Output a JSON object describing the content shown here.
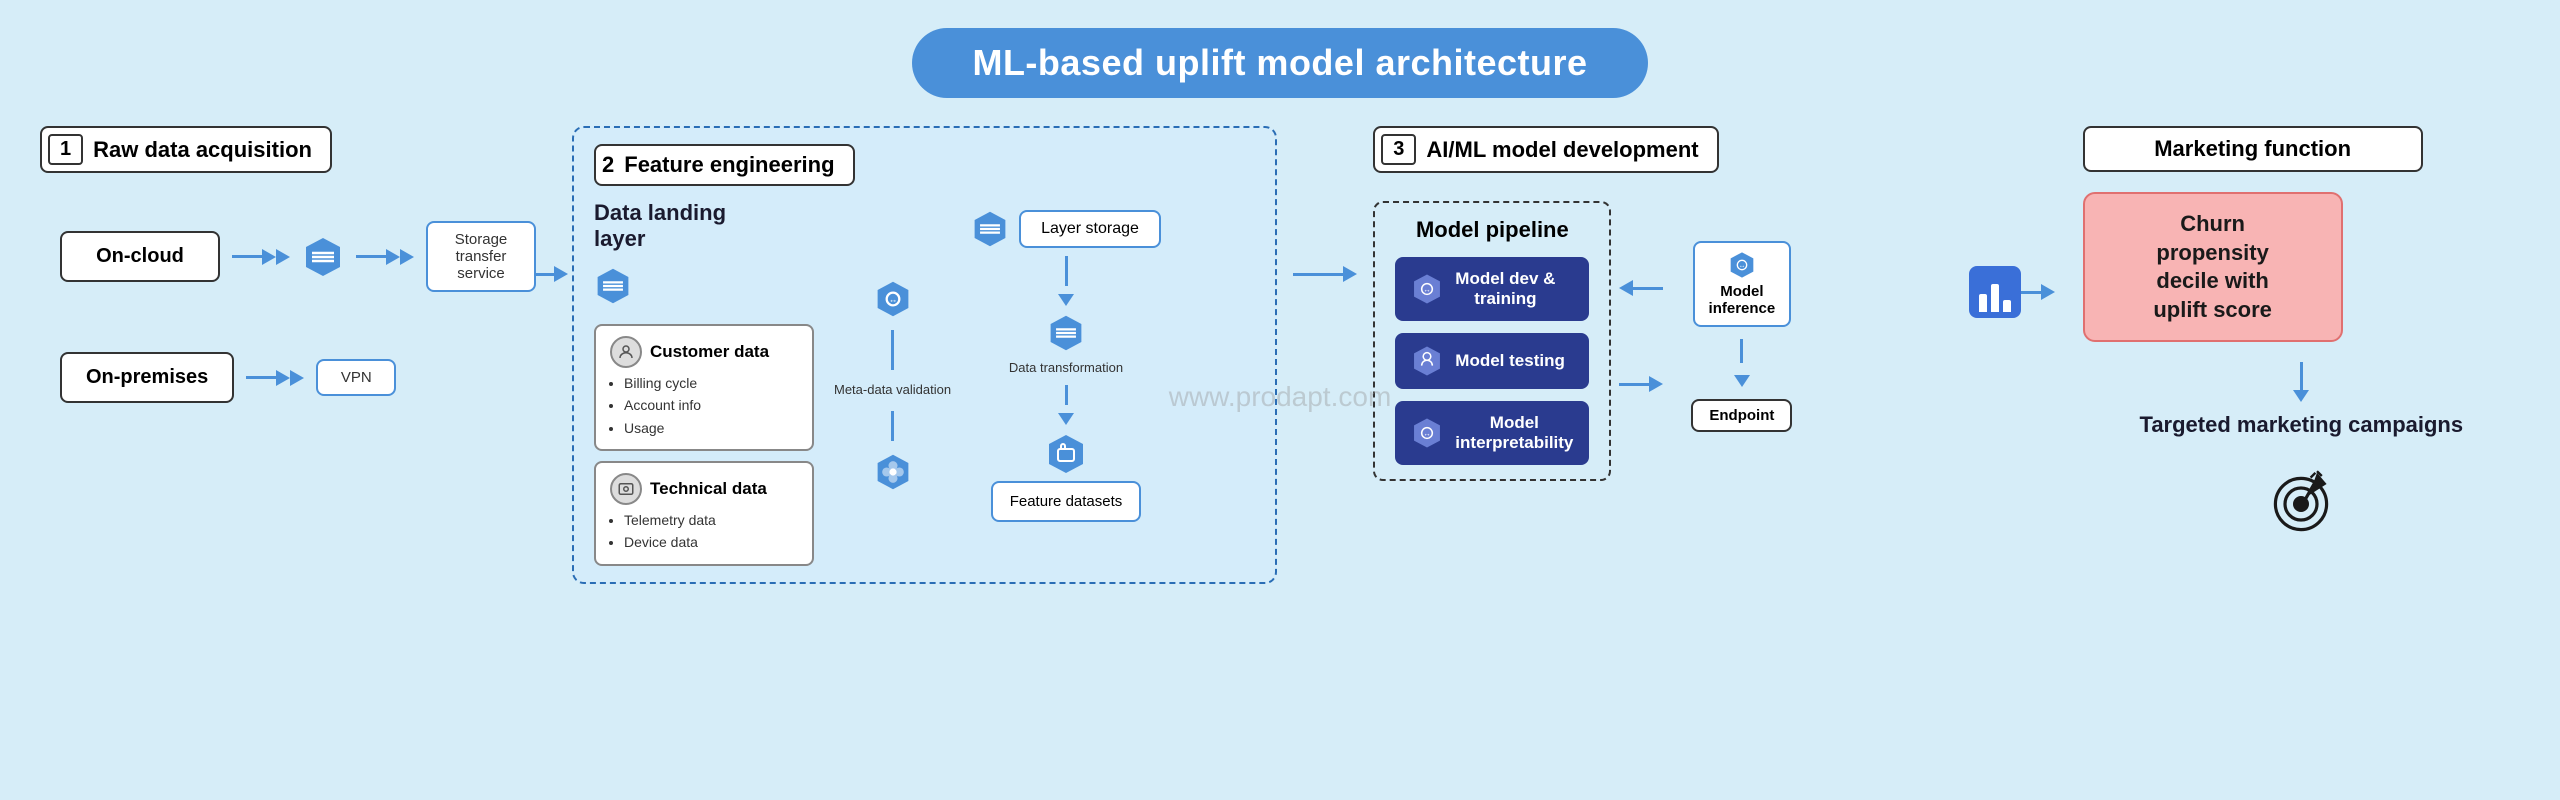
{
  "title": "ML-based uplift model architecture",
  "sections": {
    "section1": {
      "num": "1",
      "label": "Raw data acquisition",
      "sources": [
        {
          "name": "On-cloud",
          "transfer": "Storage transfer service"
        },
        {
          "name": "On-premises",
          "transfer": "VPN"
        }
      ]
    },
    "section2": {
      "num": "2",
      "label": "Feature engineering",
      "landing_title": "Data landing\nlayer",
      "data_cards": [
        {
          "title": "Customer data",
          "items": [
            "Billing cycle",
            "Account info",
            "Usage"
          ]
        },
        {
          "title": "Technical data",
          "items": [
            "Telemetry data",
            "Device data"
          ]
        }
      ],
      "validation_label": "Meta-data\nvalidation",
      "layer_storage": "Layer storage",
      "transformation_label": "Data\ntransformation",
      "feature_datasets": "Feature datasets"
    },
    "section3": {
      "num": "3",
      "label": "AI/ML model development",
      "pipeline_title": "Model pipeline",
      "steps": [
        "Model dev &\ntraining",
        "Model testing",
        "Model\ninterpretability"
      ],
      "inference_label": "Model\ninference",
      "endpoint_label": "Endpoint"
    },
    "marketing": {
      "label": "Marketing function",
      "churn_box": "Churn\npropensity\ndecile with\nuplift score",
      "targeted_label": "Targeted marketing\ncampaigns"
    }
  },
  "watermark": "www.prodapt.com",
  "colors": {
    "primary_blue": "#4a90d9",
    "dark_navy": "#2a3b8f",
    "light_bg": "#d6edf8",
    "churn_bg": "#f8b4b4",
    "churn_border": "#e07070"
  }
}
